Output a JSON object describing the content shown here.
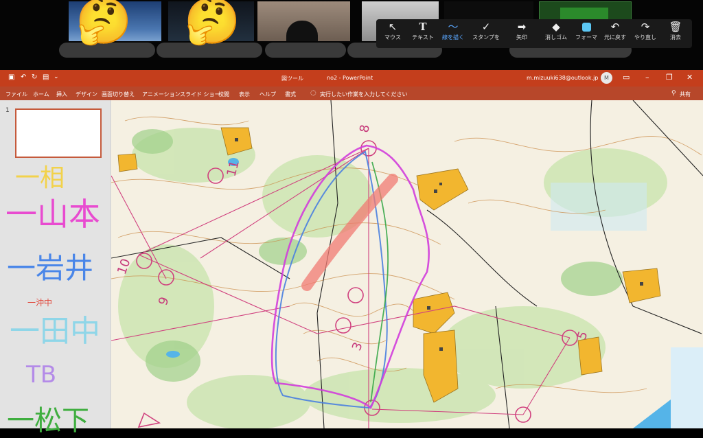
{
  "participants": {
    "tiles": [
      {
        "style": "sky",
        "emoji": "🤔"
      },
      {
        "style": "dark",
        "emoji": "🤔"
      },
      {
        "style": "room"
      },
      {
        "style": "room2"
      },
      {
        "style": "dark"
      }
    ]
  },
  "toolbar": {
    "tools": [
      {
        "icon": "pointer",
        "glyph": "↖",
        "label": "マウス"
      },
      {
        "icon": "text",
        "glyph": "T",
        "label": "テキスト"
      },
      {
        "icon": "pen",
        "glyph": "〜",
        "label": "線を描く",
        "active": true
      },
      {
        "icon": "stamp",
        "glyph": "✓",
        "label": "スタンプを"
      },
      {
        "icon": "arrow",
        "glyph": "➡",
        "label": "矢印"
      },
      {
        "icon": "eraser",
        "glyph": "◆",
        "label": "消しゴム"
      },
      {
        "icon": "format",
        "glyph": "",
        "label": "フォーマ"
      },
      {
        "icon": "undo",
        "glyph": "↶",
        "label": "元に戻す"
      },
      {
        "icon": "redo",
        "glyph": "↷",
        "label": "やり直し"
      },
      {
        "icon": "trash",
        "glyph": "🗑",
        "label": "消去"
      }
    ],
    "format_color": "#5cc7f4"
  },
  "powerpoint": {
    "context_label": "図ツール",
    "file_title": "no2 - PowerPoint",
    "account": "m.mizuuki638@outlook.jp",
    "avatar": "M",
    "window_controls": {
      "minimize": "–",
      "restore": "❐",
      "close": "✕"
    },
    "ribbon_tabs": [
      "ファイル",
      "ホーム",
      "挿入",
      "デザイン",
      "画面切り替え",
      "アニメーション",
      "スライド ショー",
      "校閲",
      "表示",
      "ヘルプ",
      "書式"
    ],
    "tell_me": "実行したい作業を入力してください",
    "share": "共有",
    "slide_number": "1",
    "accent_color": "#c43e1c"
  },
  "annotations": {
    "names": [
      {
        "text": "一相",
        "color": "#f2d24b"
      },
      {
        "text": "一山本",
        "color": "#e84bd0"
      },
      {
        "text": "一岩井",
        "color": "#4a86e8"
      },
      {
        "text": "一沖中",
        "color": "#e0463a"
      },
      {
        "text": "一田中",
        "color": "#8fd6e8"
      },
      {
        "text": "TB",
        "color": "#b48be8"
      },
      {
        "text": "一松下",
        "color": "#3fae3f"
      }
    ]
  },
  "map": {
    "control_numbers": [
      "8",
      "11",
      "10",
      "9",
      "3",
      "5"
    ]
  }
}
